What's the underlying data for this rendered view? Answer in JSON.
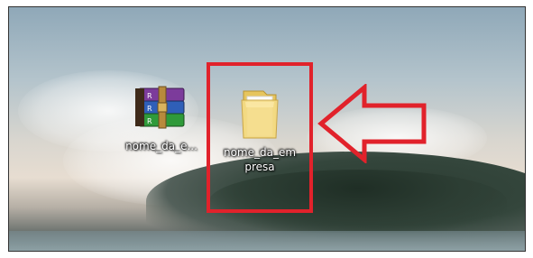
{
  "desktop": {
    "icons": [
      {
        "label": "nome_da_e...",
        "icon": "winrar-archive-icon"
      },
      {
        "label_line1": "nome_da_em",
        "label_line2": "presa",
        "icon": "folder-icon"
      }
    ]
  },
  "annotation": {
    "highlight_color": "#e1222b",
    "arrow_color": "#e1222b",
    "arrow_direction": "left"
  }
}
